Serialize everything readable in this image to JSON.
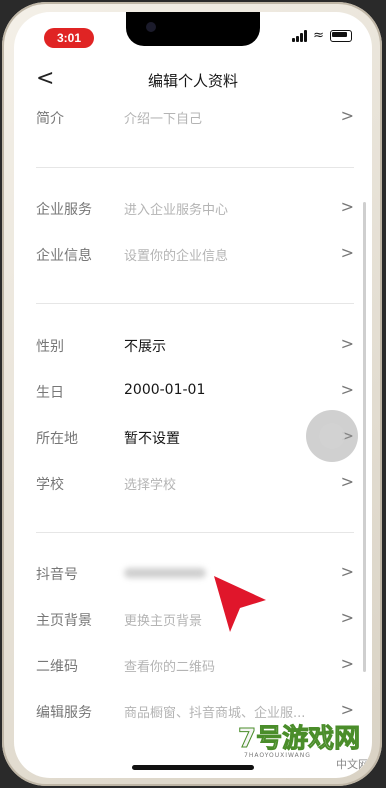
{
  "status_bar": {
    "time": "3:01"
  },
  "nav": {
    "back_glyph": "<",
    "title": "编辑个人资料"
  },
  "rows": [
    {
      "label": "简介",
      "value": "介绍一下自己"
    },
    {
      "label": "企业服务",
      "value": "进入企业服务中心"
    },
    {
      "label": "企业信息",
      "value": "设置你的企业信息"
    },
    {
      "label": "性别",
      "value": "不展示"
    },
    {
      "label": "生日",
      "value": "2000-01-01"
    },
    {
      "label": "所在地",
      "value": "暂不设置"
    },
    {
      "label": "学校",
      "value": "选择学校"
    },
    {
      "label": "抖音号",
      "value": ""
    },
    {
      "label": "主页背景",
      "value": "更换主页背景"
    },
    {
      "label": "二维码",
      "value": "查看你的二维码"
    },
    {
      "label": "编辑服务",
      "value": "商品橱窗、抖音商城、企业服..."
    }
  ],
  "chevron": ">",
  "watermark": {
    "brand": "7号游戏网",
    "sub": "7HAOYOUXIWANG",
    "cn": "中文网"
  },
  "colors": {
    "accent": "#e02424",
    "cursor": "#e0162b"
  }
}
